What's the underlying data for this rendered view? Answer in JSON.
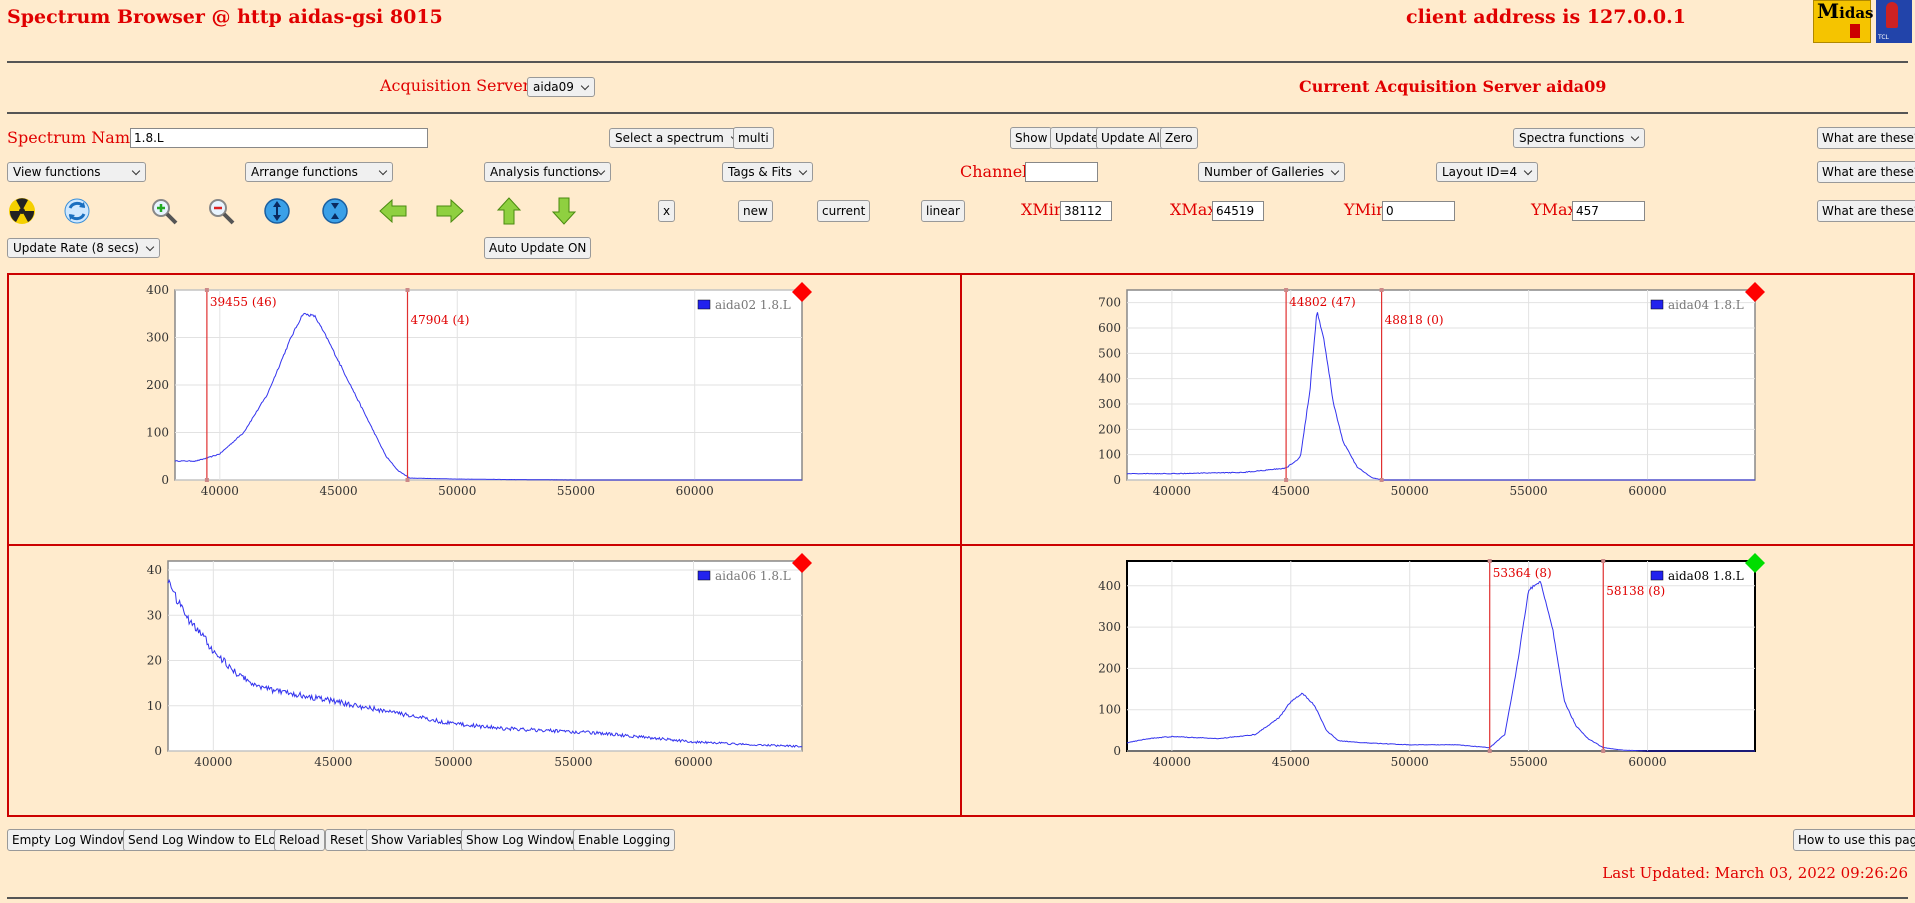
{
  "header": {
    "title": "Spectrum Browser @ http aidas-gsi 8015",
    "client_address": "client address is 127.0.0.1"
  },
  "acquisition": {
    "label": "Acquisition Servers",
    "selected": "aida09",
    "current": "Current Acquisition Server aida09"
  },
  "row1": {
    "name_label": "Spectrum Name:",
    "name_value": "1.8.L",
    "select_spectrum": "Select a spectrum",
    "multi": "multi",
    "show": "Show",
    "update": "Update",
    "update_all": "Update All",
    "zero": "Zero",
    "spectra_functions": "Spectra functions",
    "what": "What are these?"
  },
  "row2": {
    "view_functions": "View functions",
    "arrange_functions": "Arrange functions",
    "analysis_functions": "Analysis functions",
    "tags_fits": "Tags & Fits",
    "channel_label": "Channel:",
    "channel_value": "",
    "galleries": "Number of Galleries",
    "layout": "Layout ID=4",
    "what": "What are these?"
  },
  "row3": {
    "x": "x",
    "new": "new",
    "current": "current",
    "linear": "linear",
    "xmin_label": "XMin",
    "xmin": "38112",
    "xmax_label": "XMax",
    "xmax": "64519",
    "ymin_label": "YMin",
    "ymin": "0",
    "ymax_label": "YMax",
    "ymax": "457",
    "what": "What are these?",
    "icons": [
      "radiation-icon",
      "refresh-icon",
      "zoom-in-icon",
      "zoom-out-icon",
      "expand-y-icon",
      "shrink-y-icon",
      "arrow-left-icon",
      "arrow-right-icon",
      "arrow-up-icon",
      "arrow-down-icon"
    ]
  },
  "row4": {
    "update_rate": "Update Rate (8 secs)",
    "auto_update": "Auto Update ON"
  },
  "footer": {
    "empty_log": "Empty Log Window",
    "send_log": "Send Log Window to ELog",
    "reload": "Reload",
    "reset": "Reset",
    "show_vars": "Show Variables",
    "show_log": "Show Log Window",
    "enable_logging": "Enable Logging",
    "how_to": "How to use this page",
    "last_updated": "Last Updated: March 03, 2022 09:26:26"
  },
  "colors": {
    "accent": "#e00000",
    "background": "#ffebcd",
    "series": "#3333ee",
    "status_red": "#ff0000",
    "status_green": "#00dd00"
  },
  "chart_data": [
    {
      "type": "line",
      "series": [
        {
          "name": "aida02 1.8.L"
        }
      ],
      "xlim": [
        38112,
        64519
      ],
      "ylim": [
        0,
        400
      ],
      "xticks": [
        40000,
        45000,
        50000,
        55000,
        60000
      ],
      "yticks": [
        0,
        100,
        200,
        300,
        400
      ],
      "x": [
        38112,
        39000,
        39455,
        40000,
        41000,
        42000,
        42500,
        43000,
        43500,
        44000,
        44500,
        45000,
        45500,
        46000,
        46500,
        47000,
        47500,
        48000,
        49000,
        50000,
        52000,
        55000,
        60000,
        64519
      ],
      "y": [
        40,
        40,
        46,
        55,
        100,
        180,
        240,
        300,
        350,
        345,
        300,
        250,
        200,
        150,
        100,
        50,
        20,
        4,
        3,
        2,
        1,
        0,
        0,
        0
      ],
      "markers": [
        {
          "x": 39455,
          "label": "39455 (46)"
        },
        {
          "x": 47904,
          "label": "47904 (4)"
        }
      ],
      "status": "red"
    },
    {
      "type": "line",
      "series": [
        {
          "name": "aida04 1.8.L"
        }
      ],
      "xlim": [
        38112,
        64519
      ],
      "ylim": [
        0,
        750
      ],
      "xticks": [
        40000,
        45000,
        50000,
        55000,
        60000
      ],
      "yticks": [
        0,
        100,
        200,
        300,
        400,
        500,
        600,
        700
      ],
      "x": [
        38112,
        40000,
        43000,
        44802,
        45400,
        45800,
        46100,
        46400,
        46800,
        47200,
        47800,
        48400,
        48818,
        50000,
        55000,
        64519
      ],
      "y": [
        25,
        25,
        30,
        47,
        90,
        350,
        670,
        550,
        300,
        150,
        50,
        10,
        0,
        0,
        0,
        0
      ],
      "markers": [
        {
          "x": 44802,
          "label": "44802 (47)"
        },
        {
          "x": 48818,
          "label": "48818 (0)"
        }
      ],
      "status": "red"
    },
    {
      "type": "line",
      "series": [
        {
          "name": "aida06 1.8.L"
        }
      ],
      "xlim": [
        38112,
        64519
      ],
      "ylim": [
        0,
        42
      ],
      "xticks": [
        40000,
        45000,
        50000,
        55000,
        60000
      ],
      "yticks": [
        0,
        10,
        20,
        30,
        40
      ],
      "x": [
        38112,
        38500,
        39000,
        39500,
        40000,
        41000,
        42000,
        43000,
        44000,
        45000,
        46000,
        47000,
        48000,
        50000,
        52000,
        54000,
        56000,
        58000,
        60000,
        62000,
        64519
      ],
      "y": [
        38,
        33,
        29,
        26,
        22,
        17,
        14,
        13,
        12,
        11,
        10,
        9,
        8,
        6,
        5,
        4.5,
        4,
        3,
        2,
        1.5,
        1
      ],
      "markers": [],
      "status": "red"
    },
    {
      "type": "line",
      "series": [
        {
          "name": "aida08 1.8.L"
        }
      ],
      "xlim": [
        38112,
        64519
      ],
      "ylim": [
        0,
        460
      ],
      "xticks": [
        40000,
        45000,
        50000,
        55000,
        60000
      ],
      "yticks": [
        0,
        100,
        200,
        300,
        400
      ],
      "x": [
        38112,
        39000,
        40000,
        42000,
        43500,
        44500,
        45000,
        45500,
        46000,
        46500,
        47000,
        48000,
        50000,
        52000,
        53364,
        54000,
        54500,
        55000,
        55500,
        56000,
        56500,
        57000,
        57500,
        58138,
        59000,
        60000,
        64519
      ],
      "y": [
        20,
        30,
        35,
        30,
        40,
        80,
        120,
        140,
        110,
        50,
        25,
        20,
        15,
        15,
        8,
        40,
        200,
        390,
        410,
        300,
        120,
        60,
        30,
        8,
        2,
        0,
        0
      ],
      "markers": [
        {
          "x": 53364,
          "label": "53364 (8)"
        },
        {
          "x": 58138,
          "label": "58138 (8)"
        }
      ],
      "status": "green"
    }
  ]
}
